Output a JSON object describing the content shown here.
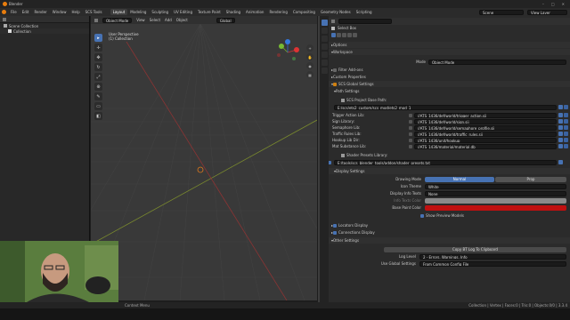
{
  "app": {
    "title": "Blender"
  },
  "menu": {
    "items": [
      "File",
      "Edit",
      "Render",
      "Window",
      "Help",
      "SCS Tools"
    ],
    "workspaces": [
      "Layout",
      "Modeling",
      "Sculpting",
      "UV Editing",
      "Texture Paint",
      "Shading",
      "Animation",
      "Rendering",
      "Compositing",
      "Geometry Nodes",
      "Scripting"
    ],
    "active_workspace": "Layout",
    "scene": "Scene",
    "view_layer": "View Layer"
  },
  "outliner": {
    "rows": [
      "Scene Collection",
      "Collection"
    ]
  },
  "viewport": {
    "mode": "Object Mode",
    "header_menus": [
      "View",
      "Select",
      "Add",
      "Object"
    ],
    "transform_orientation": "Global",
    "info_line1": "User Perspective",
    "info_line2": "(1) Collection"
  },
  "properties": {
    "breadcrumb": "Scene",
    "header_field": "Select Box",
    "options_label": "Options",
    "workspace_label": "Workspace",
    "mode_label": "Mode",
    "mode_value": "Object Mode",
    "filter_addons": "Filter Add-ons",
    "custom_properties": "Custom Properties",
    "scs_global": "SCS Global Settings",
    "path_settings": "Path Settings",
    "project_base_path_label": "SCS Project Base Path:",
    "project_base_path": "E:/scs/ets2_custom/scs_mod/ets2_mod_1",
    "libs": [
      {
        "label": "Trigger Action Lib:",
        "value": "//ATS_1436/def/world/trigger_action.sii"
      },
      {
        "label": "Sign Library:",
        "value": "//ATS_1436/def/world/sign.sii"
      },
      {
        "label": "Semaphore Lib:",
        "value": "//ATS_1436/def/world/semaphore_profile.sii"
      },
      {
        "label": "Traffic Rules Lib:",
        "value": "//ATS_1436/def/world/traffic_rules.sii"
      },
      {
        "label": "Hookup Lib Dir:",
        "value": "//ATS_1436/unit/hookup"
      },
      {
        "label": "Mat Substance Lib:",
        "value": "//ATS_1436/material/material.db"
      }
    ],
    "shader_presets_label": "Shader Presets Library:",
    "shader_presets_value": "E:/tools/scs_blender_tools/addon/shader_presets.txt",
    "display_settings": "Display Settings",
    "drawing_mode_label": "Drawing Mode",
    "drawing_mode_options": [
      "Normal",
      "Prop"
    ],
    "icon_theme_label": "Icon Theme",
    "icon_theme_value": "White",
    "display_info_label": "Display Info Texts",
    "display_info_value": "None",
    "info_texts_color_label": "Info Texts Color",
    "base_paint_color_label": "Base Paint Color",
    "base_paint_color": "#c01010",
    "show_preview_models": "Show Preview Models",
    "locators_display": "Locators Display",
    "connections_display": "Connections Display",
    "other_settings": "Other Settings",
    "copy_log_button": "Copy BT Log To Clipboard",
    "log_level_label": "Log Level",
    "log_level_value": "2 - Errors, Warnings, Info",
    "use_global_label": "Use Global Settings",
    "use_global_value": "From Common Config File"
  },
  "status": {
    "left": "Context Menu",
    "right": "Collection | Vertex | Faces:0 | Tris:0 | Objects:0/0 | 3.3.4"
  }
}
